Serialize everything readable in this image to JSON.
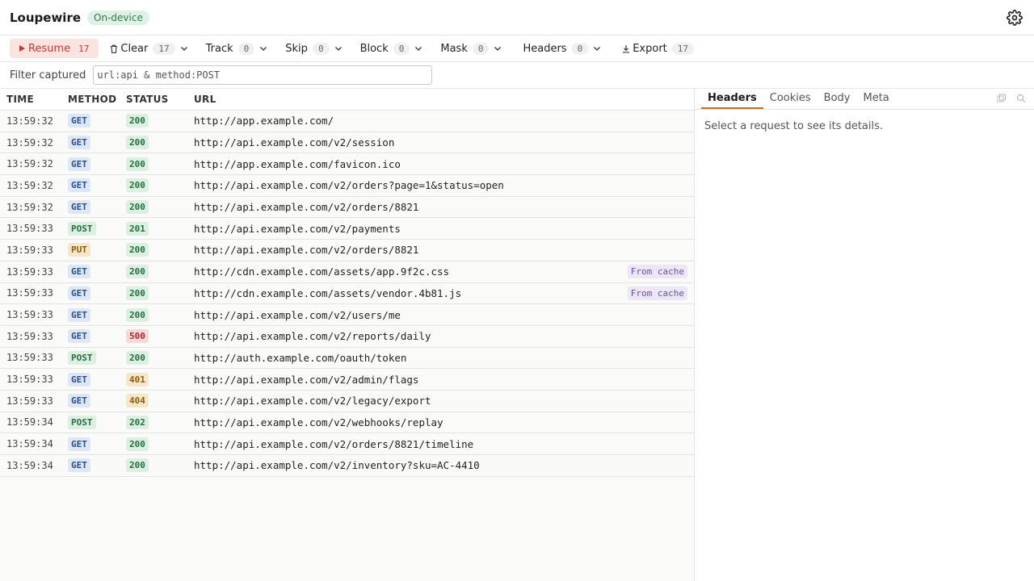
{
  "app": {
    "title": "Loupewire",
    "badge": "On-device"
  },
  "toolbar": {
    "resume": {
      "label": "Resume",
      "count": "17"
    },
    "clear": {
      "label": "Clear",
      "count": "17"
    },
    "track": {
      "label": "Track",
      "count": "0"
    },
    "skip": {
      "label": "Skip",
      "count": "0"
    },
    "block": {
      "label": "Block",
      "count": "0"
    },
    "mask": {
      "label": "Mask",
      "count": "0"
    },
    "headers": {
      "label": "Headers",
      "count": "0"
    },
    "export": {
      "label": "Export",
      "count": "17"
    }
  },
  "filter": {
    "label": "Filter captured",
    "value": "url:api & method:POST"
  },
  "table": {
    "headers": {
      "time": "TIME",
      "method": "METHOD",
      "status": "STATUS",
      "url": "URL"
    },
    "rows": [
      {
        "time": "13:59:32",
        "method": "GET",
        "status": "200",
        "url": "http://app.example.com/",
        "cache": ""
      },
      {
        "time": "13:59:32",
        "method": "GET",
        "status": "200",
        "url": "http://api.example.com/v2/session",
        "cache": ""
      },
      {
        "time": "13:59:32",
        "method": "GET",
        "status": "200",
        "url": "http://app.example.com/favicon.ico",
        "cache": ""
      },
      {
        "time": "13:59:32",
        "method": "GET",
        "status": "200",
        "url": "http://api.example.com/v2/orders?page=1&status=open",
        "cache": ""
      },
      {
        "time": "13:59:32",
        "method": "GET",
        "status": "200",
        "url": "http://api.example.com/v2/orders/8821",
        "cache": ""
      },
      {
        "time": "13:59:33",
        "method": "POST",
        "status": "201",
        "url": "http://api.example.com/v2/payments",
        "cache": ""
      },
      {
        "time": "13:59:33",
        "method": "PUT",
        "status": "200",
        "url": "http://api.example.com/v2/orders/8821",
        "cache": ""
      },
      {
        "time": "13:59:33",
        "method": "GET",
        "status": "200",
        "url": "http://cdn.example.com/assets/app.9f2c.css",
        "cache": "From cache"
      },
      {
        "time": "13:59:33",
        "method": "GET",
        "status": "200",
        "url": "http://cdn.example.com/assets/vendor.4b81.js",
        "cache": "From cache"
      },
      {
        "time": "13:59:33",
        "method": "GET",
        "status": "200",
        "url": "http://api.example.com/v2/users/me",
        "cache": ""
      },
      {
        "time": "13:59:33",
        "method": "GET",
        "status": "500",
        "url": "http://api.example.com/v2/reports/daily",
        "cache": ""
      },
      {
        "time": "13:59:33",
        "method": "POST",
        "status": "200",
        "url": "http://auth.example.com/oauth/token",
        "cache": ""
      },
      {
        "time": "13:59:33",
        "method": "GET",
        "status": "401",
        "url": "http://api.example.com/v2/admin/flags",
        "cache": ""
      },
      {
        "time": "13:59:33",
        "method": "GET",
        "status": "404",
        "url": "http://api.example.com/v2/legacy/export",
        "cache": ""
      },
      {
        "time": "13:59:34",
        "method": "POST",
        "status": "202",
        "url": "http://api.example.com/v2/webhooks/replay",
        "cache": ""
      },
      {
        "time": "13:59:34",
        "method": "GET",
        "status": "200",
        "url": "http://api.example.com/v2/orders/8821/timeline",
        "cache": ""
      },
      {
        "time": "13:59:34",
        "method": "GET",
        "status": "200",
        "url": "http://api.example.com/v2/inventory?sku=AC-4410",
        "cache": ""
      }
    ]
  },
  "detail": {
    "tabs": [
      "Headers",
      "Cookies",
      "Body",
      "Meta"
    ],
    "active_tab": "Headers",
    "empty_message": "Select a request to see its details."
  },
  "icons": {
    "settings": "gear-icon",
    "resume": "play-icon",
    "clear": "trash-icon",
    "export": "download-icon",
    "copy": "copy-icon",
    "search": "search-icon",
    "dropdown": "chevron-down-icon"
  },
  "colors": {
    "accent": "#c0392b",
    "tab_underline": "#c0702b",
    "ondevice_badge": "#def1e4",
    "cache_badge": "#ece6f7"
  }
}
